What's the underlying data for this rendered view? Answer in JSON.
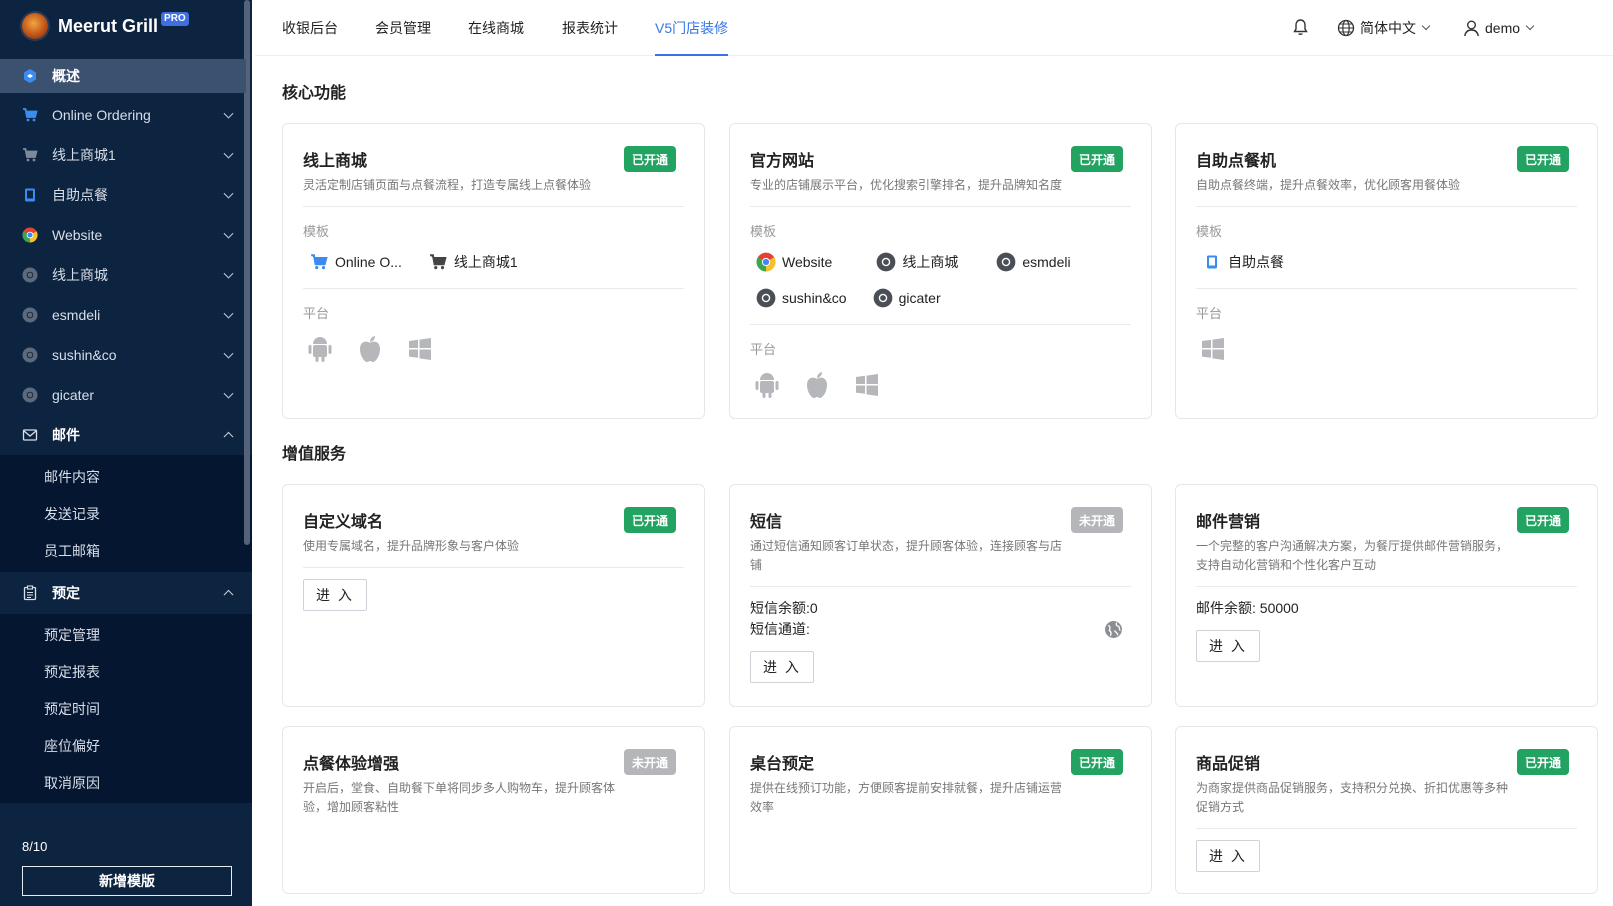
{
  "brand": {
    "name": "Meerut Grill",
    "badge": "PRO"
  },
  "sidebar": {
    "items": [
      {
        "label": "概述"
      },
      {
        "label": "Online Ordering"
      },
      {
        "label": "线上商城1"
      },
      {
        "label": "自助点餐"
      },
      {
        "label": "Website"
      },
      {
        "label": "线上商城"
      },
      {
        "label": "esmdeli"
      },
      {
        "label": "sushin&co"
      },
      {
        "label": "gicater"
      },
      {
        "label": "邮件"
      },
      {
        "label": "预定"
      }
    ],
    "mail_sub": [
      "邮件内容",
      "发送记录",
      "员工邮箱"
    ],
    "reserve_sub": [
      "预定管理",
      "预定报表",
      "预定时间",
      "座位偏好",
      "取消原因"
    ],
    "count": "8/10",
    "add_button": "新增模版"
  },
  "topbar": {
    "tabs": [
      "收银后台",
      "会员管理",
      "在线商城",
      "报表统计",
      "V5门店装修"
    ],
    "language": "简体中文",
    "user": "demo"
  },
  "sections": {
    "core": "核心功能",
    "value_added": "增值服务"
  },
  "labels": {
    "template": "模板",
    "platform": "平台",
    "enter": "进 入"
  },
  "status": {
    "on": "已开通",
    "off": "未开通"
  },
  "cards": {
    "mall": {
      "title": "线上商城",
      "desc": "灵活定制店铺页面与点餐流程，打造专属线上点餐体验",
      "status": "已开通",
      "templates": [
        "Online O...",
        "线上商城1"
      ]
    },
    "website": {
      "title": "官方网站",
      "desc": "专业的店铺展示平台，优化搜索引擎排名，提升品牌知名度",
      "status": "已开通",
      "templates": [
        "Website",
        "线上商城",
        "esmdeli",
        "sushin&co",
        "gicater"
      ]
    },
    "kiosk": {
      "title": "自助点餐机",
      "desc": "自助点餐终端，提升点餐效率，优化顾客用餐体验",
      "status": "已开通",
      "templates": [
        "自助点餐"
      ]
    },
    "domain": {
      "title": "自定义域名",
      "desc": "使用专属域名，提升品牌形象与客户体验",
      "status": "已开通"
    },
    "sms": {
      "title": "短信",
      "desc": "通过短信通知顾客订单状态，提升顾客体验，连接顾客与店铺",
      "status": "未开通",
      "balance": "短信余额:0",
      "channel": "短信通道:"
    },
    "email": {
      "title": "邮件营销",
      "desc": "一个完整的客户沟通解决方案，为餐厅提供邮件营销服务，支持自动化营销和个性化客户互动",
      "status": "已开通",
      "balance": "邮件余额: 50000"
    },
    "dining": {
      "title": "点餐体验增强",
      "desc": "开启后，堂食、自助餐下单将同步多人购物车，提升顾客体验，增加顾客粘性",
      "status": "未开通"
    },
    "table": {
      "title": "桌台预定",
      "desc": "提供在线预订功能，方便顾客提前安排就餐，提升店铺运营效率",
      "status": "已开通"
    },
    "promo": {
      "title": "商品促销",
      "desc": "为商家提供商品促销服务，支持积分兑换、折扣优惠等多种促销方式",
      "status": "已开通"
    }
  }
}
